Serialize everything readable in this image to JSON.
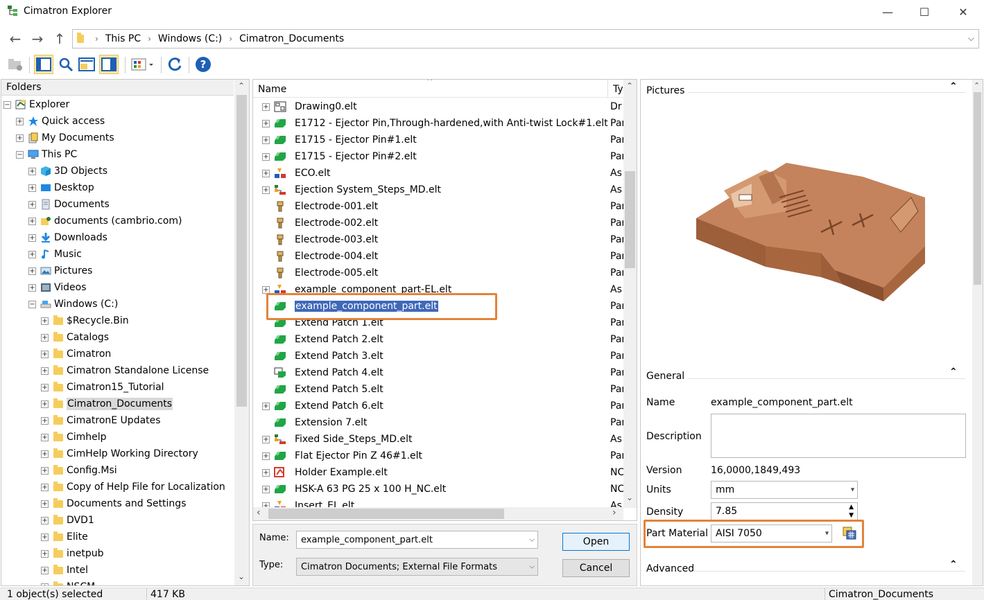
{
  "window": {
    "title": "Cimatron Explorer",
    "minimize": "—",
    "maximize": "☐",
    "close": "✕"
  },
  "address": {
    "crumbs": [
      "This PC",
      "Windows (C:)",
      "Cimatron_Documents"
    ]
  },
  "folders_pane": {
    "header": "Folders",
    "items": [
      {
        "label": "Explorer",
        "level": 0,
        "expander": "−",
        "icon": "explorer-icon"
      },
      {
        "label": "Quick access",
        "level": 1,
        "expander": "+",
        "icon": "star-icon"
      },
      {
        "label": "My Documents",
        "level": 1,
        "expander": "+",
        "icon": "documents-icon"
      },
      {
        "label": "This PC",
        "level": 1,
        "expander": "−",
        "icon": "computer-icon"
      },
      {
        "label": "3D Objects",
        "level": 2,
        "expander": "+",
        "icon": "cube-icon"
      },
      {
        "label": "Desktop",
        "level": 2,
        "expander": "+",
        "icon": "desktop-icon"
      },
      {
        "label": "Documents",
        "level": 2,
        "expander": "+",
        "icon": "document-icon"
      },
      {
        "label": "documents (cambrio.com)",
        "level": 2,
        "expander": "+",
        "icon": "shared-folder-icon"
      },
      {
        "label": "Downloads",
        "level": 2,
        "expander": "+",
        "icon": "download-icon"
      },
      {
        "label": "Music",
        "level": 2,
        "expander": "+",
        "icon": "music-icon"
      },
      {
        "label": "Pictures",
        "level": 2,
        "expander": "+",
        "icon": "pictures-icon"
      },
      {
        "label": "Videos",
        "level": 2,
        "expander": "+",
        "icon": "videos-icon"
      },
      {
        "label": "Windows (C:)",
        "level": 2,
        "expander": "−",
        "icon": "drive-icon"
      },
      {
        "label": "$Recycle.Bin",
        "level": 3,
        "expander": "+",
        "icon": "folder-icon"
      },
      {
        "label": "Catalogs",
        "level": 3,
        "expander": "+",
        "icon": "folder-icon"
      },
      {
        "label": "Cimatron",
        "level": 3,
        "expander": "+",
        "icon": "folder-icon"
      },
      {
        "label": "Cimatron Standalone License",
        "level": 3,
        "expander": "+",
        "icon": "folder-icon"
      },
      {
        "label": "Cimatron15_Tutorial",
        "level": 3,
        "expander": "+",
        "icon": "folder-icon"
      },
      {
        "label": "Cimatron_Documents",
        "level": 3,
        "expander": "+",
        "icon": "folder-icon",
        "selected": true
      },
      {
        "label": "CimatronE Updates",
        "level": 3,
        "expander": "+",
        "icon": "folder-icon"
      },
      {
        "label": "Cimhelp",
        "level": 3,
        "expander": "+",
        "icon": "folder-icon"
      },
      {
        "label": "CimHelp Working Directory",
        "level": 3,
        "expander": "+",
        "icon": "folder-icon"
      },
      {
        "label": "Config.Msi",
        "level": 3,
        "expander": "+",
        "icon": "folder-icon"
      },
      {
        "label": "Copy of Help File for Localization",
        "level": 3,
        "expander": "+",
        "icon": "folder-icon"
      },
      {
        "label": "Documents and Settings",
        "level": 3,
        "expander": "+",
        "icon": "folder-icon"
      },
      {
        "label": "DVD1",
        "level": 3,
        "expander": "+",
        "icon": "folder-icon"
      },
      {
        "label": "Elite",
        "level": 3,
        "expander": "+",
        "icon": "folder-icon"
      },
      {
        "label": "inetpub",
        "level": 3,
        "expander": "+",
        "icon": "folder-icon"
      },
      {
        "label": "Intel",
        "level": 3,
        "expander": "+",
        "icon": "folder-icon"
      },
      {
        "label": "NSCM",
        "level": 3,
        "expander": "+",
        "icon": "folder-icon"
      }
    ]
  },
  "files_pane": {
    "columns": {
      "name": "Name",
      "type": "Ty"
    },
    "rows": [
      {
        "name": "Drawing0.elt",
        "type": "Dr",
        "exp": true,
        "icon": "drawing-icon"
      },
      {
        "name": "E1712 - Ejector Pin,Through-hardened,with Anti-twist Lock#1.elt",
        "type": "Par",
        "exp": true,
        "icon": "part-icon"
      },
      {
        "name": "E1715 - Ejector Pin#1.elt",
        "type": "Par",
        "exp": true,
        "icon": "part-icon"
      },
      {
        "name": "E1715 - Ejector Pin#2.elt",
        "type": "Par",
        "exp": true,
        "icon": "part-icon"
      },
      {
        "name": "ECO.elt",
        "type": "As",
        "exp": true,
        "icon": "assembly-icon"
      },
      {
        "name": "Ejection System_Steps_MD.elt",
        "type": "As",
        "exp": true,
        "icon": "assembly-steps-icon"
      },
      {
        "name": "Electrode-001.elt",
        "type": "Par",
        "exp": false,
        "icon": "electrode-icon"
      },
      {
        "name": "Electrode-002.elt",
        "type": "Par",
        "exp": false,
        "icon": "electrode-icon"
      },
      {
        "name": "Electrode-003.elt",
        "type": "Par",
        "exp": false,
        "icon": "electrode-icon"
      },
      {
        "name": "Electrode-004.elt",
        "type": "Par",
        "exp": false,
        "icon": "electrode-icon"
      },
      {
        "name": "Electrode-005.elt",
        "type": "Par",
        "exp": false,
        "icon": "electrode-icon"
      },
      {
        "name": "example_component_part-EL.elt",
        "type": "As",
        "exp": true,
        "icon": "assembly-icon"
      },
      {
        "name": "example_component_part.elt",
        "type": "Par",
        "exp": false,
        "icon": "part-icon",
        "selected": true
      },
      {
        "name": "Extend Patch 1.elt",
        "type": "Par",
        "exp": false,
        "icon": "part-icon"
      },
      {
        "name": "Extend Patch 2.elt",
        "type": "Par",
        "exp": false,
        "icon": "part-icon"
      },
      {
        "name": "Extend Patch 3.elt",
        "type": "Par",
        "exp": false,
        "icon": "part-icon"
      },
      {
        "name": "Extend Patch 4.elt",
        "type": "Par",
        "exp": false,
        "icon": "patch-icon"
      },
      {
        "name": "Extend Patch 5.elt",
        "type": "Par",
        "exp": false,
        "icon": "part-icon"
      },
      {
        "name": "Extend Patch 6.elt",
        "type": "Par",
        "exp": true,
        "icon": "part-icon"
      },
      {
        "name": "Extension 7.elt",
        "type": "Par",
        "exp": false,
        "icon": "part-icon"
      },
      {
        "name": "Fixed Side_Steps_MD.elt",
        "type": "As",
        "exp": true,
        "icon": "assembly-steps-icon"
      },
      {
        "name": "Flat Ejector Pin Z 46#1.elt",
        "type": "Par",
        "exp": true,
        "icon": "part-icon"
      },
      {
        "name": "Holder Example.elt",
        "type": "NC",
        "exp": true,
        "icon": "nc-icon"
      },
      {
        "name": "HSK-A 63  PG 25 x 100 H_NC.elt",
        "type": "NC",
        "exp": true,
        "icon": "part-icon"
      },
      {
        "name": "Insert_EL.elt",
        "type": "As",
        "exp": true,
        "icon": "assembly-icon"
      }
    ]
  },
  "file_dialog": {
    "name_label": "Name:",
    "name_value": "example_component_part.elt",
    "type_label": "Type:",
    "type_value": "Cimatron Documents; External File Formats",
    "open_button": "Open",
    "cancel_button": "Cancel"
  },
  "properties_pane": {
    "pictures_header": "Pictures",
    "general_header": "General",
    "name_label": "Name",
    "name_value": "example_component_part.elt",
    "description_label": "Description",
    "description_value": "",
    "version_label": "Version",
    "version_value": "16,0000,1849,493",
    "units_label": "Units",
    "units_value": "mm",
    "density_label": "Density",
    "density_value": "7.85",
    "material_label": "Part Material",
    "material_value": "AISI 7050",
    "advanced_header": "Advanced"
  },
  "status_bar": {
    "selection": "1 object(s) selected",
    "size": "417 KB",
    "location": "Cimatron_Documents"
  },
  "colors": {
    "accent_highlight": "#e4833a",
    "selection": "#3f68b9",
    "part_color": "#b87650"
  }
}
